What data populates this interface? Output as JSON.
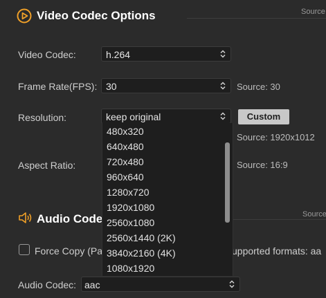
{
  "video_section": {
    "title": "Video Codec Options",
    "source_tag": "Source",
    "codec": {
      "label": "Video Codec:",
      "value": "h.264"
    },
    "frame_rate": {
      "label": "Frame Rate(FPS):",
      "value": "30",
      "source": "Source: 30"
    },
    "resolution": {
      "label": "Resolution:",
      "value": "keep original",
      "custom_button": "Custom",
      "source": "Source: 1920x1012",
      "options": [
        "480x320",
        "640x480",
        "720x480",
        "960x640",
        "1280x720",
        "1920x1080",
        "2560x1080",
        "2560x1440 (2K)",
        "3840x2160 (4K)",
        "1080x1920"
      ]
    },
    "aspect_ratio": {
      "label": "Aspect Ratio:",
      "source": "Source: 16:9"
    }
  },
  "audio_section": {
    "title": "Audio Codec",
    "source_tag": "Source",
    "force_copy_label": "Force Copy (Pa",
    "supported_formats_text": "upported formats: aa",
    "codec": {
      "label": "Audio Codec:",
      "value": "aac"
    }
  },
  "colors": {
    "background": "#2b2b2b",
    "accent_icon": "#f0a028",
    "button": "#c8c8c8"
  }
}
